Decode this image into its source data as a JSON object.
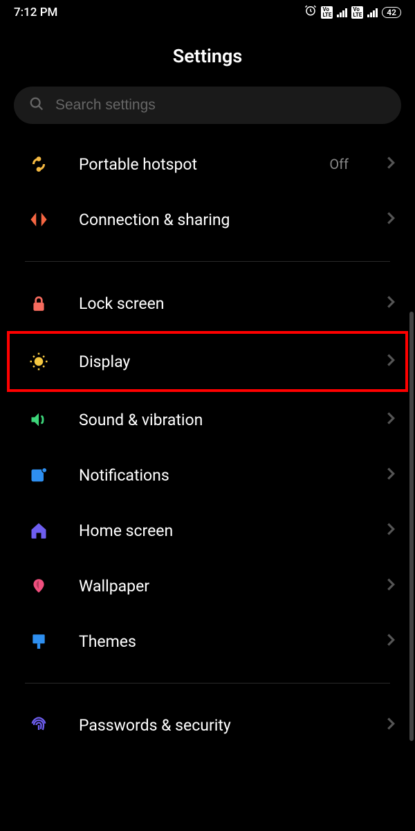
{
  "status": {
    "time": "7:12 PM",
    "battery": "42"
  },
  "header": {
    "title": "Settings"
  },
  "search": {
    "placeholder": "Search settings"
  },
  "sections": [
    {
      "items": [
        {
          "label": "Portable hotspot",
          "value": "Off"
        },
        {
          "label": "Connection & sharing"
        }
      ]
    },
    {
      "items": [
        {
          "label": "Lock screen"
        },
        {
          "label": "Display",
          "highlighted": true
        },
        {
          "label": "Sound & vibration"
        },
        {
          "label": "Notifications"
        },
        {
          "label": "Home screen"
        },
        {
          "label": "Wallpaper"
        },
        {
          "label": "Themes"
        }
      ]
    },
    {
      "items": [
        {
          "label": "Passwords & security"
        }
      ]
    }
  ]
}
